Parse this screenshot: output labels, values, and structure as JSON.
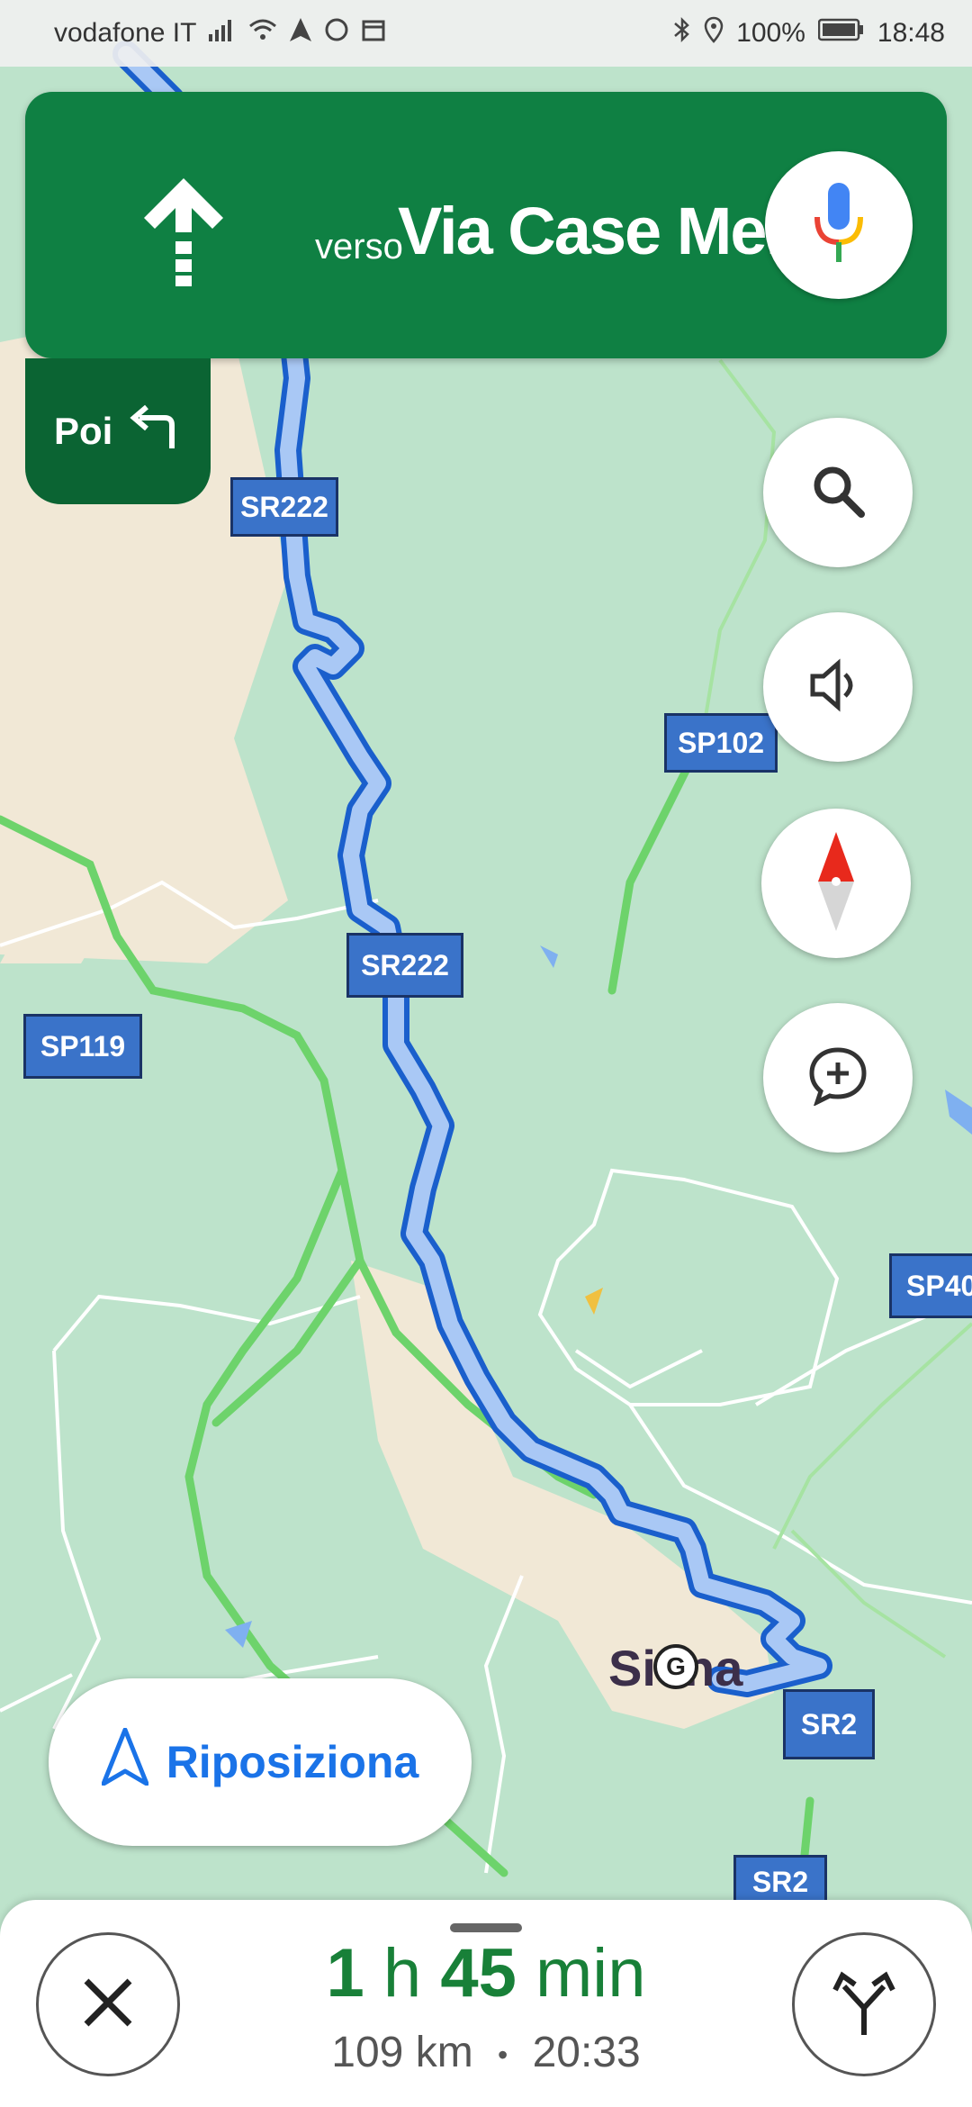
{
  "status_bar": {
    "carrier": "vodafone IT",
    "battery": "100%",
    "time": "18:48"
  },
  "navigation": {
    "direction_prefix": "verso",
    "street_name": "Via Case Melli",
    "then_label": "Poi"
  },
  "map": {
    "road_shields": [
      "SR222",
      "SR222",
      "SP102",
      "SP119",
      "SP40",
      "SR2",
      "SR2"
    ],
    "city_label": "Siena",
    "marker_letter": "G"
  },
  "recenter": {
    "label": "Riposiziona"
  },
  "trip": {
    "hours": "1",
    "hours_unit": "h",
    "minutes": "45",
    "minutes_unit": "min",
    "distance": "109 km",
    "separator": "•",
    "arrival_time": "20:33"
  },
  "colors": {
    "nav_green": "#0f8043",
    "then_green": "#0b6433",
    "route_blue": "#1a73e8",
    "eta_green": "#188038"
  }
}
